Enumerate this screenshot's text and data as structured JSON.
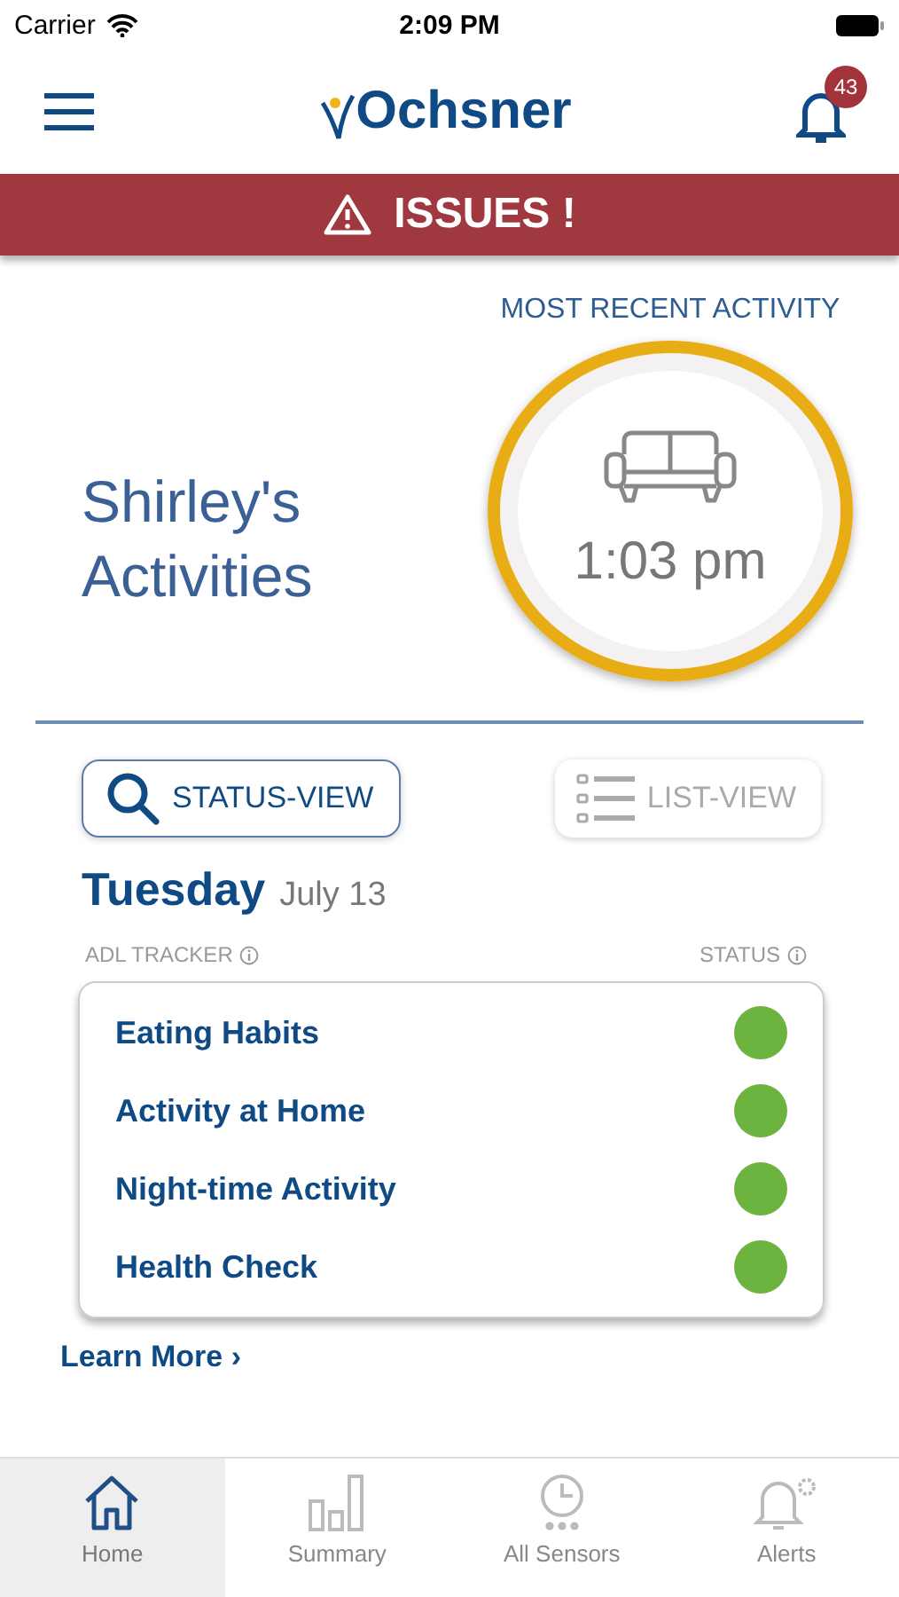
{
  "status_bar": {
    "carrier": "Carrier",
    "time": "2:09 PM"
  },
  "header": {
    "logo": "Ochsner",
    "badge": "43"
  },
  "banner": {
    "text": "ISSUES !"
  },
  "recent": {
    "label": "MOST RECENT ACTIVITY",
    "time": "1:03 pm"
  },
  "title": "Shirley's Activities",
  "views": [
    {
      "label": "STATUS-VIEW",
      "kind": "search",
      "selected": true
    },
    {
      "label": "LIST-VIEW",
      "kind": "list",
      "selected": false
    }
  ],
  "day": {
    "weekday": "Tuesday",
    "date": "July 13"
  },
  "columns": [
    "ADL TRACKER",
    "STATUS"
  ],
  "trackers": [
    {
      "name": "Eating Habits",
      "color": "#6db33f"
    },
    {
      "name": "Activity at Home",
      "color": "#6db33f"
    },
    {
      "name": "Night-time Activity",
      "color": "#6db33f"
    },
    {
      "name": "Health Check",
      "color": "#6db33f"
    }
  ],
  "learn_more": "Learn More ›",
  "tabs": [
    {
      "label": "Home",
      "kind": "home",
      "selected": true
    },
    {
      "label": "Summary",
      "kind": "summary",
      "selected": false
    },
    {
      "label": "All Sensors",
      "kind": "sensors",
      "selected": false
    },
    {
      "label": "Alerts",
      "kind": "alerts",
      "selected": false
    }
  ]
}
